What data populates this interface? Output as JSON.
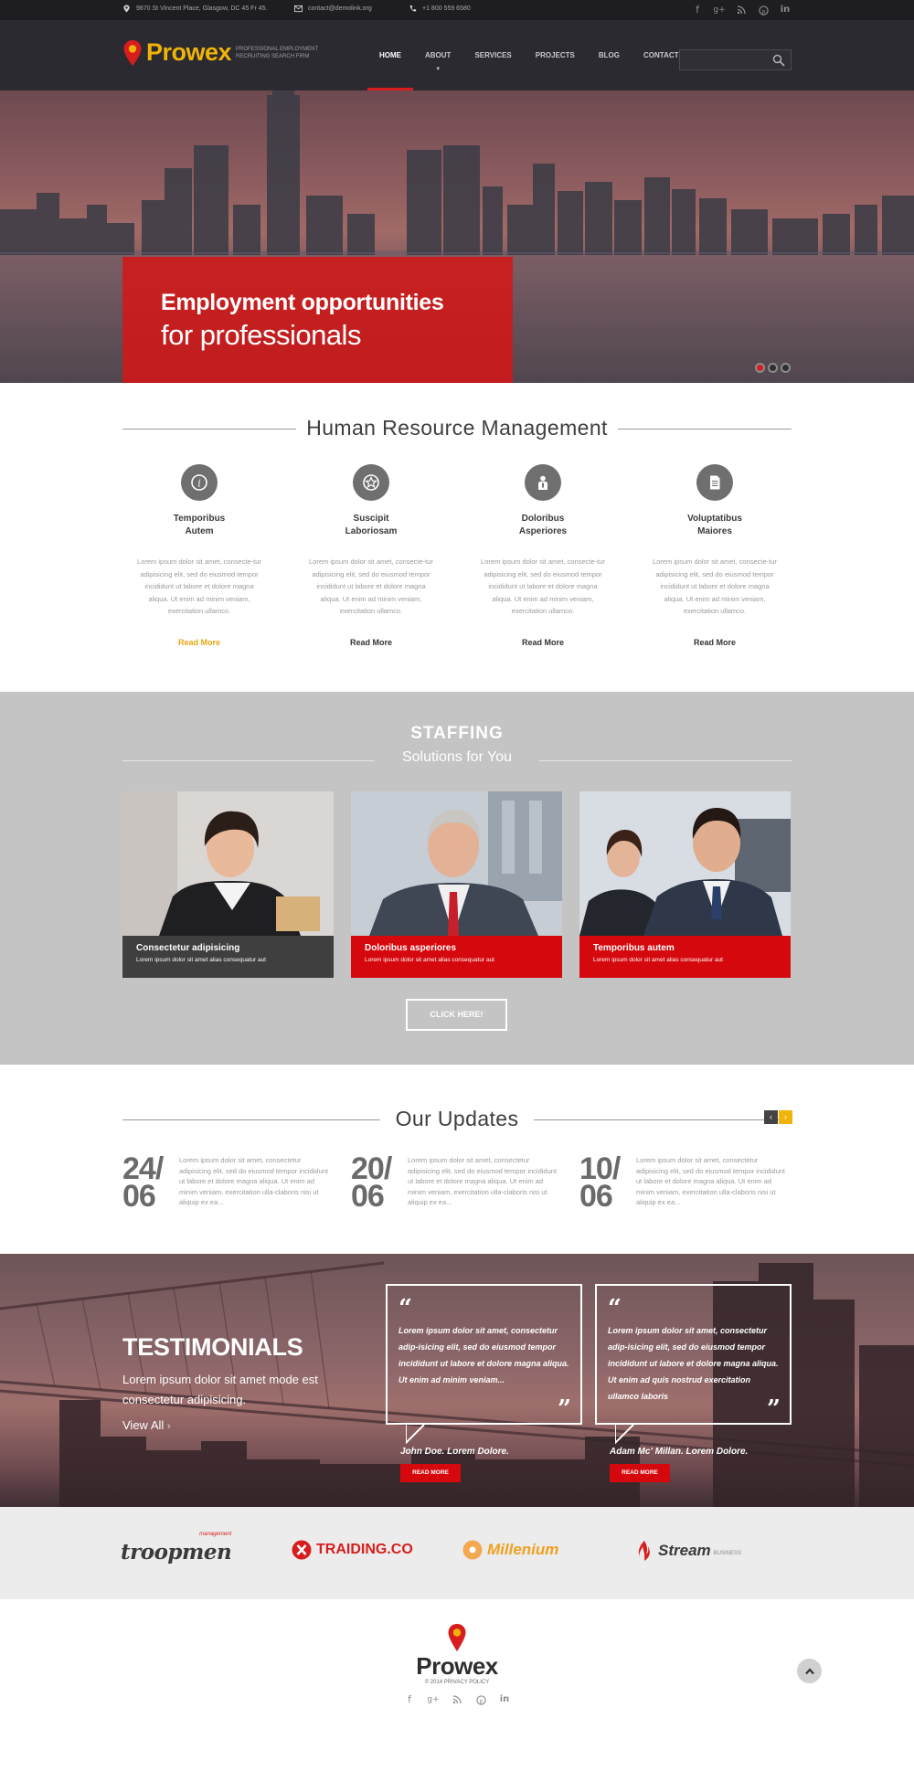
{
  "topbar": {
    "address": "9870 St Vincent Place, Glasgow, DC 45 Fr 45.",
    "email": "contact@demolink.org",
    "phone": "+1 800 559 6580",
    "social": [
      "f",
      "g+",
      "rss",
      "p",
      "in"
    ]
  },
  "header": {
    "logo_name": "Prowex",
    "logo_tagline_1": "PROFESSIONAL EMPLOYMENT",
    "logo_tagline_2": "RECRUITING SEARCH FIRM",
    "nav": [
      "HOME",
      "ABOUT",
      "SERVICES",
      "PROJECTS",
      "BLOG",
      "CONTACTS"
    ],
    "active_nav": "HOME",
    "search_placeholder": ""
  },
  "hero": {
    "line1": "Employment opportunities",
    "line2": "for professionals",
    "slides": 3,
    "active_slide": 1
  },
  "hr": {
    "title": "Human Resource Management",
    "items": [
      {
        "title1": "Temporibus",
        "title2": "Autem",
        "icon": "info-icon",
        "text": "Lorem ipsum dolor sit amet, consecte-tur adipisicing elit, sed do eiusmod tempor incididunt ut labore et dolore magna aliqua. Ut enim ad minim veniam, exercitation ullamco.",
        "more": "Read More"
      },
      {
        "title1": "Suscipit",
        "title2": "Laboriosam",
        "icon": "star-icon",
        "text": "Lorem ipsum dolor sit amet, consecte-tur adipisicing elit, sed do eiusmod tempor incididunt ut labore et dolore magna aliqua. Ut enim ad minim veniam, exercitation ullamco.",
        "more": "Read More"
      },
      {
        "title1": "Doloribus",
        "title2": "Asperiores",
        "icon": "person-icon",
        "text": "Lorem ipsum dolor sit amet, consecte-tur adipisicing elit, sed do eiusmod tempor incididunt ut labore et dolore magna aliqua. Ut enim ad minim veniam, exercitation ullamco.",
        "more": "Read More"
      },
      {
        "title1": "Voluptatibus",
        "title2": "Maiores",
        "icon": "document-icon",
        "text": "Lorem ipsum dolor sit amet, consecte-tur adipisicing elit, sed do eiusmod tempor incididunt ut labore et dolore magna aliqua. Ut enim ad minim veniam, exercitation ullamco.",
        "more": "Read More"
      }
    ]
  },
  "staffing": {
    "title": "STAFFING",
    "subtitle": "Solutions for You",
    "cards": [
      {
        "title": "Consectetur adipisicing",
        "text": "Lorem ipsum dolor sit amet alias consequatur aut"
      },
      {
        "title": "Doloribus asperiores",
        "text": "Lorem ipsum dolor sit amet alias consequatur aut"
      },
      {
        "title": "Temporibus autem",
        "text": "Lorem ipsum dolor sit amet alias consequatur aut"
      }
    ],
    "button": "CLICK HERE!"
  },
  "updates": {
    "title": "Our Updates",
    "items": [
      {
        "day": "24/",
        "month": "06",
        "text": "Lorem ipsum dolor sit amet, consectetur adipisicing elit, sed do eiusmod tempor incididunt ut labore et dolore magna aliqua. Ut enim ad minim veniam, exercitation ulla-claboris nisi ut aliquip ex ea..."
      },
      {
        "day": "20/",
        "month": "06",
        "text": "Lorem ipsum dolor sit amet, consectetur adipisicing elit, sed do eiusmod tempor incididunt ut labore et dolore magna aliqua. Ut enim ad minim veniam, exercitation ulla-claboris nisi ut aliquip ex ea..."
      },
      {
        "day": "10/",
        "month": "06",
        "text": "Lorem ipsum dolor sit amet, consectetur adipisicing elit, sed do eiusmod tempor incididunt ut labore et dolore magna aliqua. Ut enim ad minim veniam, exercitation ulla-claboris nisi ut aliquip ex ea..."
      }
    ],
    "prev": "‹",
    "next": "›"
  },
  "testimonials": {
    "title": "TESTIMONIALS",
    "subtitle": "Lorem ipsum dolor sit amet mode est consectetur adipisicing.",
    "view_all": "View All",
    "quotes": [
      {
        "text": "Lorem ipsum dolor sit amet, consectetur adip-isicing elit, sed do eiusmod tempor incididunt ut labore et dolore magna aliqua. Ut enim ad minim veniam...",
        "author": "John Doe.  Lorem Dolore.",
        "button": "READ MORE"
      },
      {
        "text": "Lorem ipsum dolor sit amet, consectetur adip-isicing elit, sed do eiusmod tempor incididunt ut labore et dolore magna aliqua. Ut enim ad quis nostrud exercitation ullamco laboris",
        "author": "Adam Mc' Millan.  Lorem Dolore.",
        "button": "READ MORE"
      }
    ]
  },
  "brands": {
    "troopmen": "troopmen",
    "troopmen_tag": "management",
    "traiding": "TRAIDING.CO",
    "millenium": "Millenium",
    "stream": "Stream",
    "stream_tag": "BUSINESS"
  },
  "footer": {
    "logo_name": "Prowex",
    "copyright": "© 2014 PRIVACY POLICY",
    "social": [
      "f",
      "g+",
      "rss",
      "p",
      "in"
    ]
  },
  "colors": {
    "accent_red": "#d71d1d",
    "accent_yellow": "#f0b30a",
    "dark_bar": "#1e1e22"
  }
}
